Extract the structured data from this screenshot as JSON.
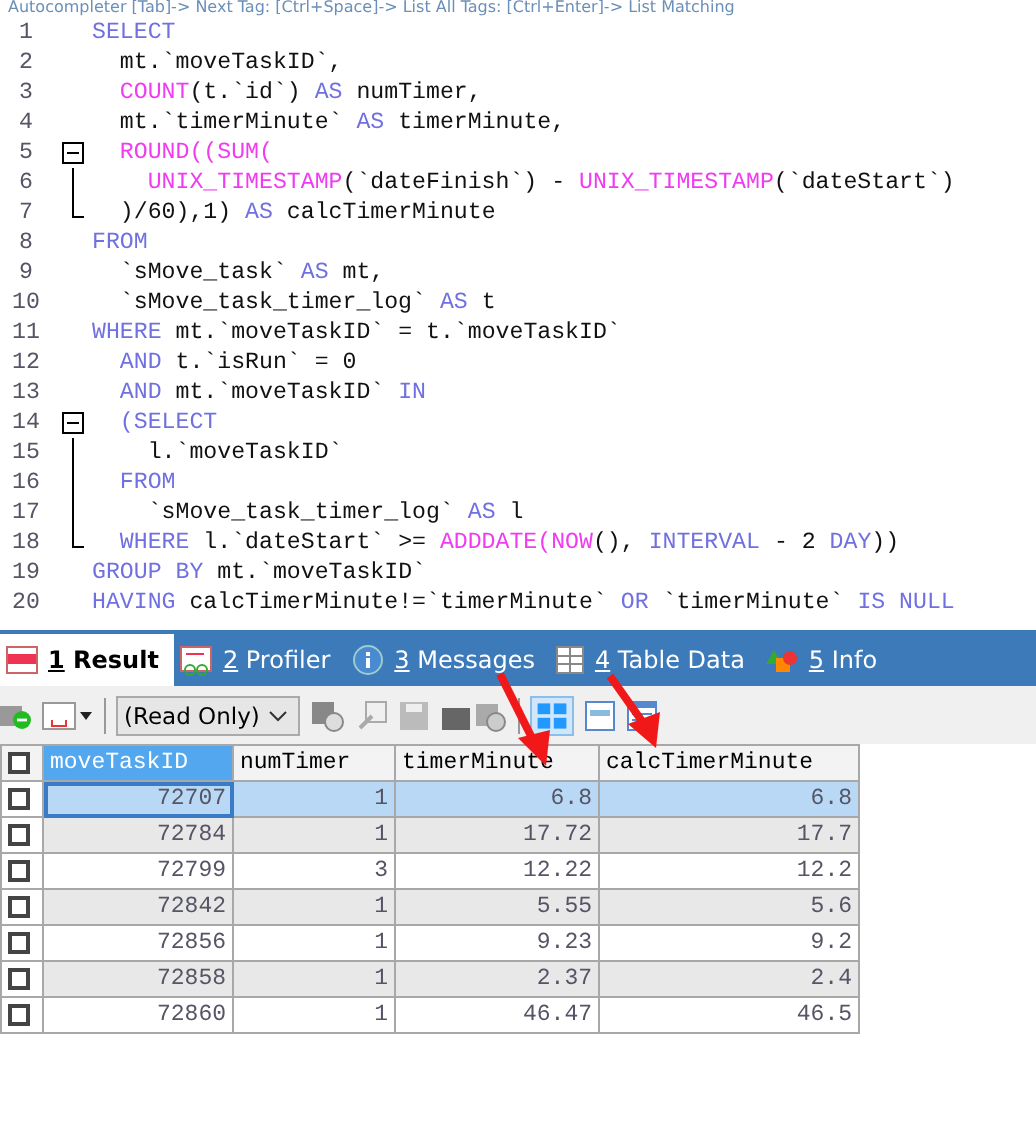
{
  "hint_bar": {
    "text": "Autocompleter [Tab]-> Next Tag: [Ctrl+Space]-> List All Tags: [Ctrl+Enter]-> List Matching"
  },
  "editor": {
    "lines": [
      {
        "number": "1",
        "kind": "none",
        "tokens": [
          {
            "kind": "kw",
            "text": "SELECT"
          }
        ]
      },
      {
        "number": "2",
        "kind": "none",
        "tokens": [
          {
            "kind": "plain",
            "text": "  mt.`moveTaskID`,"
          }
        ]
      },
      {
        "number": "3",
        "kind": "none",
        "tokens": [
          {
            "kind": "fn",
            "text": "  COUNT"
          },
          {
            "kind": "plain",
            "text": "(t.`id`) "
          },
          {
            "kind": "kw",
            "text": "AS"
          },
          {
            "kind": "plain",
            "text": " numTimer,"
          }
        ]
      },
      {
        "number": "4",
        "kind": "none",
        "tokens": [
          {
            "kind": "plain",
            "text": "  mt.`timerMinute` "
          },
          {
            "kind": "kw",
            "text": "AS"
          },
          {
            "kind": "plain",
            "text": " timerMinute,"
          }
        ]
      },
      {
        "number": "5",
        "kind": "fold_start",
        "tokens": [
          {
            "kind": "fn",
            "text": "  ROUND((SUM("
          }
        ]
      },
      {
        "number": "6",
        "kind": "fold_mid",
        "tokens": [
          {
            "kind": "fn",
            "text": "    UNIX_TIMESTAMP"
          },
          {
            "kind": "plain",
            "text": "(`dateFinish`) - "
          },
          {
            "kind": "fn",
            "text": "UNIX_TIMESTAMP"
          },
          {
            "kind": "plain",
            "text": "(`dateStart`)"
          }
        ]
      },
      {
        "number": "7",
        "kind": "fold_end",
        "tokens": [
          {
            "kind": "plain",
            "text": "  )/60),1) "
          },
          {
            "kind": "kw",
            "text": "AS"
          },
          {
            "kind": "plain",
            "text": " calcTimerMinute"
          }
        ]
      },
      {
        "number": "8",
        "kind": "none",
        "tokens": [
          {
            "kind": "kw",
            "text": "FROM"
          }
        ]
      },
      {
        "number": "9",
        "kind": "none",
        "tokens": [
          {
            "kind": "plain",
            "text": "  `sMove_task` "
          },
          {
            "kind": "kw",
            "text": "AS"
          },
          {
            "kind": "plain",
            "text": " mt,"
          }
        ]
      },
      {
        "number": "10",
        "kind": "none",
        "tokens": [
          {
            "kind": "plain",
            "text": "  `sMove_task_timer_log` "
          },
          {
            "kind": "kw",
            "text": "AS"
          },
          {
            "kind": "plain",
            "text": " t"
          }
        ]
      },
      {
        "number": "11",
        "kind": "none",
        "tokens": [
          {
            "kind": "kw",
            "text": "WHERE"
          },
          {
            "kind": "plain",
            "text": " mt.`moveTaskID` = t.`moveTaskID`"
          }
        ]
      },
      {
        "number": "12",
        "kind": "none",
        "tokens": [
          {
            "kind": "kw",
            "text": "  AND"
          },
          {
            "kind": "plain",
            "text": " t.`isRun` = 0"
          }
        ]
      },
      {
        "number": "13",
        "kind": "none",
        "tokens": [
          {
            "kind": "kw",
            "text": "  AND"
          },
          {
            "kind": "plain",
            "text": " mt.`moveTaskID` "
          },
          {
            "kind": "kw",
            "text": "IN"
          }
        ]
      },
      {
        "number": "14",
        "kind": "fold_start",
        "tokens": [
          {
            "kind": "kw",
            "text": "  (SELECT"
          }
        ]
      },
      {
        "number": "15",
        "kind": "fold_mid",
        "tokens": [
          {
            "kind": "plain",
            "text": "    l.`moveTaskID`"
          }
        ]
      },
      {
        "number": "16",
        "kind": "fold_mid",
        "tokens": [
          {
            "kind": "kw",
            "text": "  FROM"
          }
        ]
      },
      {
        "number": "17",
        "kind": "fold_mid",
        "tokens": [
          {
            "kind": "plain",
            "text": "    `sMove_task_timer_log` "
          },
          {
            "kind": "kw",
            "text": "AS"
          },
          {
            "kind": "plain",
            "text": " l"
          }
        ]
      },
      {
        "number": "18",
        "kind": "fold_end",
        "tokens": [
          {
            "kind": "kw",
            "text": "  WHERE"
          },
          {
            "kind": "plain",
            "text": " l.`dateStart` >= "
          },
          {
            "kind": "fn",
            "text": "ADDDATE(NOW"
          },
          {
            "kind": "plain",
            "text": "(), "
          },
          {
            "kind": "kw",
            "text": "INTERVAL"
          },
          {
            "kind": "plain",
            "text": " - 2 "
          },
          {
            "kind": "kw",
            "text": "DAY"
          },
          {
            "kind": "plain",
            "text": "))"
          }
        ]
      },
      {
        "number": "19",
        "kind": "none",
        "tokens": [
          {
            "kind": "kw",
            "text": "GROUP BY"
          },
          {
            "kind": "plain",
            "text": " mt.`moveTaskID`"
          }
        ]
      },
      {
        "number": "20",
        "kind": "none",
        "tokens": [
          {
            "kind": "kw",
            "text": "HAVING"
          },
          {
            "kind": "plain",
            "text": " calcTimerMinute!=`timerMinute` "
          },
          {
            "kind": "kw",
            "text": "OR"
          },
          {
            "kind": "plain",
            "text": " `timerMinute` "
          },
          {
            "kind": "kw",
            "text": "IS NULL"
          }
        ]
      }
    ]
  },
  "tabs": [
    {
      "kind": "result",
      "key": "1",
      "label": "Result",
      "selected": true
    },
    {
      "kind": "profiler",
      "key": "2",
      "label": "Profiler",
      "selected": false
    },
    {
      "kind": "messages",
      "key": "3",
      "label": "Messages",
      "selected": false
    },
    {
      "kind": "tabledata",
      "key": "4",
      "label": "Table Data",
      "selected": false
    },
    {
      "kind": "info",
      "key": "5",
      "label": "Info",
      "selected": false
    }
  ],
  "toolbar": {
    "mode_dropdown": {
      "value": "(Read Only)"
    }
  },
  "table": {
    "header_checked": false,
    "columns": [
      {
        "label": "moveTaskID",
        "selected": true
      },
      {
        "label": "numTimer",
        "selected": false
      },
      {
        "label": "timerMinute",
        "selected": false
      },
      {
        "label": "calcTimerMinute",
        "selected": false
      }
    ],
    "rows": [
      {
        "checked": false,
        "selected": true,
        "cells": [
          "72707",
          "1",
          "6.8",
          "6.8"
        ]
      },
      {
        "checked": false,
        "selected": false,
        "cells": [
          "72784",
          "1",
          "17.72",
          "17.7"
        ]
      },
      {
        "checked": false,
        "selected": false,
        "cells": [
          "72799",
          "3",
          "12.22",
          "12.2"
        ]
      },
      {
        "checked": false,
        "selected": false,
        "cells": [
          "72842",
          "1",
          "5.55",
          "5.6"
        ]
      },
      {
        "checked": false,
        "selected": false,
        "cells": [
          "72856",
          "1",
          "9.23",
          "9.2"
        ]
      },
      {
        "checked": false,
        "selected": false,
        "cells": [
          "72858",
          "1",
          "2.37",
          "2.4"
        ]
      },
      {
        "checked": false,
        "selected": false,
        "cells": [
          "72860",
          "1",
          "46.47",
          "46.5"
        ]
      }
    ]
  }
}
